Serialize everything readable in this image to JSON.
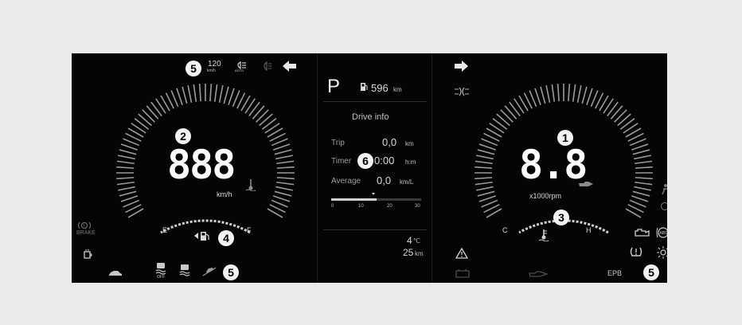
{
  "left_gauge": {
    "speed_digits": "888",
    "unit": "km/h",
    "fuel_empty": "E",
    "fuel_full": "F"
  },
  "right_gauge": {
    "rpm_digits": "8.8",
    "unit": "x1000rpm",
    "temp_cold": "C",
    "temp_hot": "H"
  },
  "top_left": {
    "speed_limit_value": "120",
    "speed_limit_unit": "km/h"
  },
  "center_panel": {
    "gear": "P",
    "range_value": "596",
    "range_unit": "km",
    "title": "Drive info",
    "rows": [
      {
        "label": "Trip",
        "value": "0,0",
        "unit": "km"
      },
      {
        "label": "Timer",
        "value": "0:00",
        "unit": "h:m"
      },
      {
        "label": "Average",
        "value": "0,0",
        "unit": "km/L"
      }
    ],
    "scale_ticks": [
      "0",
      "10",
      "20",
      "30"
    ],
    "scale_fill_fraction": 0.5,
    "temperature_value": "4",
    "temperature_unit": "℃",
    "distance_value": "25",
    "distance_unit": "km"
  },
  "warning_labels": {
    "brake": "BRAKE",
    "epb": "EPB"
  },
  "callouts": {
    "c1": "1",
    "c2": "2",
    "c3": "3",
    "c4": "4",
    "c5_top": "5",
    "c5_bottom_left": "5",
    "c5_bottom_right": "5",
    "c6": "6"
  },
  "colors": {
    "background": "#ebebeb",
    "cluster": "#050505",
    "text": "#d8d8d8",
    "callout": "#f2f2f2"
  }
}
